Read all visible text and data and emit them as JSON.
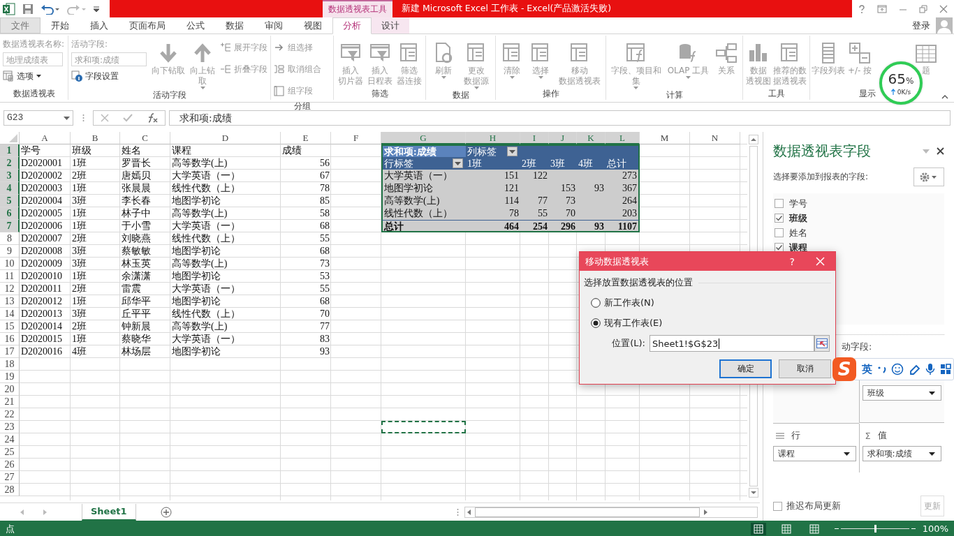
{
  "title_bar": {
    "context_tab": "数据透视表工具",
    "title": "新建 Microsoft Excel 工作表 -  Excel(产品激活失败)"
  },
  "ribbon_tabs": [
    {
      "label": "文件",
      "kind": "file",
      "selected": false
    },
    {
      "label": "开始",
      "kind": "main",
      "selected": false
    },
    {
      "label": "插入",
      "kind": "main",
      "selected": false
    },
    {
      "label": "页面布局",
      "kind": "main",
      "selected": false
    },
    {
      "label": "公式",
      "kind": "main",
      "selected": false
    },
    {
      "label": "数据",
      "kind": "main",
      "selected": false
    },
    {
      "label": "审阅",
      "kind": "main",
      "selected": false
    },
    {
      "label": "视图",
      "kind": "main",
      "selected": false
    },
    {
      "label": "分析",
      "kind": "context",
      "selected": true
    },
    {
      "label": "设计",
      "kind": "context",
      "selected": false
    }
  ],
  "account": {
    "label": "登录"
  },
  "ribbon_groups": [
    {
      "label": "数据透视表",
      "columns": [
        [
          {
            "kind": "caption",
            "text": "数据透视表名称:",
            "disabled": true
          },
          {
            "kind": "input",
            "value": "地理成绩表",
            "disabled": true
          },
          {
            "kind": "small",
            "text": "选项",
            "dropdown": true,
            "disabled": false
          }
        ]
      ]
    },
    {
      "label": "活动字段",
      "columns": [
        [
          {
            "kind": "caption",
            "text": "活动字段:",
            "disabled": true
          },
          {
            "kind": "input",
            "value": "求和项:成绩",
            "disabled": true
          },
          {
            "kind": "small",
            "text": "字段设置",
            "dropdown": false,
            "disabled": false
          }
        ],
        [
          {
            "kind": "large",
            "lines": [
              "向下钻取"
            ],
            "dropdown": false,
            "disabled": true
          }
        ],
        [
          {
            "kind": "large",
            "lines": [
              "向上钻",
              "取"
            ],
            "dropdown": true,
            "disabled": true
          }
        ],
        [
          {
            "kind": "small",
            "text": "展开字段",
            "dropdown": false,
            "disabled": true
          },
          {
            "kind": "small",
            "text": "折叠字段",
            "dropdown": false,
            "disabled": true
          }
        ]
      ]
    },
    {
      "label": "分组",
      "columns": [
        [
          {
            "kind": "small",
            "text": "组选择",
            "dropdown": false,
            "disabled": true
          },
          {
            "kind": "small",
            "text": "取消组合",
            "dropdown": false,
            "disabled": true
          },
          {
            "kind": "small",
            "text": "组字段",
            "dropdown": false,
            "disabled": true
          }
        ]
      ]
    },
    {
      "label": "筛选",
      "columns": [
        [
          {
            "kind": "large",
            "lines": [
              "插入",
              "切片器"
            ],
            "dropdown": false,
            "disabled": true
          }
        ],
        [
          {
            "kind": "large",
            "lines": [
              "插入",
              "日程表"
            ],
            "dropdown": false,
            "disabled": true
          }
        ],
        [
          {
            "kind": "large",
            "lines": [
              "筛选",
              "器连接"
            ],
            "dropdown": false,
            "disabled": true
          }
        ]
      ]
    },
    {
      "label": "数据",
      "columns": [
        [
          {
            "kind": "large",
            "lines": [
              "刷新"
            ],
            "dropdown": true,
            "disabled": true
          }
        ],
        [
          {
            "kind": "large",
            "lines": [
              "更改",
              "数据源"
            ],
            "dropdown": true,
            "disabled": true
          }
        ]
      ]
    },
    {
      "label": "操作",
      "columns": [
        [
          {
            "kind": "large",
            "lines": [
              "清除"
            ],
            "dropdown": true,
            "disabled": true
          }
        ],
        [
          {
            "kind": "large",
            "lines": [
              "选择"
            ],
            "dropdown": true,
            "disabled": true
          }
        ],
        [
          {
            "kind": "large",
            "lines": [
              "移动",
              "数据透视表"
            ],
            "dropdown": false,
            "disabled": true
          }
        ]
      ]
    },
    {
      "label": "计算",
      "columns": [
        [
          {
            "kind": "large",
            "lines": [
              "字段、项目和",
              "集"
            ],
            "dropdown": true,
            "disabled": true
          }
        ],
        [
          {
            "kind": "large",
            "lines": [
              "OLAP 工具"
            ],
            "dropdown": true,
            "disabled": true
          }
        ],
        [
          {
            "kind": "large",
            "lines": [
              "关系"
            ],
            "dropdown": false,
            "disabled": true
          }
        ]
      ]
    },
    {
      "label": "工具",
      "columns": [
        [
          {
            "kind": "large",
            "lines": [
              "数据",
              "透视图"
            ],
            "dropdown": false,
            "disabled": true
          }
        ],
        [
          {
            "kind": "large",
            "lines": [
              "推荐的数",
              "据透视表"
            ],
            "dropdown": false,
            "disabled": true
          }
        ]
      ]
    },
    {
      "label": "显示",
      "columns": [
        [
          {
            "kind": "large",
            "lines": [
              "字段列表"
            ],
            "dropdown": false,
            "disabled": true
          }
        ],
        [
          {
            "kind": "large",
            "lines": [
              "+/- 按"
            ],
            "dropdown": false,
            "disabled": true
          }
        ],
        [
          {
            "kind": "large",
            "lines": [
              "题"
            ],
            "dropdown": false,
            "disabled": true
          }
        ]
      ]
    }
  ],
  "formula_bar": {
    "name_box": "G23",
    "formula": "求和项:成绩"
  },
  "sheet": {
    "column_headers": [
      {
        "label": "A",
        "selected": false,
        "marquee": false
      },
      {
        "label": "B",
        "selected": false,
        "marquee": false
      },
      {
        "label": "C",
        "selected": false,
        "marquee": false
      },
      {
        "label": "D",
        "selected": false,
        "marquee": false
      },
      {
        "label": "E",
        "selected": false,
        "marquee": false
      },
      {
        "label": "F",
        "selected": false,
        "marquee": false
      },
      {
        "label": "G",
        "selected": true,
        "marquee": true
      },
      {
        "label": "H",
        "selected": true,
        "marquee": false
      },
      {
        "label": "I",
        "selected": true,
        "marquee": false
      },
      {
        "label": "J",
        "selected": true,
        "marquee": false
      },
      {
        "label": "K",
        "selected": true,
        "marquee": false
      },
      {
        "label": "L",
        "selected": true,
        "marquee": false
      },
      {
        "label": "M",
        "selected": false,
        "marquee": false
      },
      {
        "label": "N",
        "selected": false,
        "marquee": false
      }
    ],
    "rows": [
      {
        "number": "1",
        "selected": true,
        "marquee": false,
        "cells": [
          "学号",
          "班级",
          "姓名",
          "课程",
          "成绩"
        ]
      },
      {
        "number": "2",
        "selected": true,
        "marquee": false,
        "cells": [
          "D2020001",
          "1班",
          "罗晋长",
          "高等数学(上)",
          "56"
        ]
      },
      {
        "number": "3",
        "selected": true,
        "marquee": false,
        "cells": [
          "D2020002",
          "2班",
          "唐嫣贝",
          "大学英语（一）",
          "67"
        ]
      },
      {
        "number": "4",
        "selected": true,
        "marquee": false,
        "cells": [
          "D2020003",
          "1班",
          "张晨晨",
          "线性代数（上）",
          "78"
        ]
      },
      {
        "number": "5",
        "selected": true,
        "marquee": false,
        "cells": [
          "D2020004",
          "3班",
          "李长春",
          "地图学初论",
          "85"
        ]
      },
      {
        "number": "6",
        "selected": true,
        "marquee": false,
        "cells": [
          "D2020005",
          "1班",
          "林子中",
          "高等数学(上)",
          "58"
        ]
      },
      {
        "number": "7",
        "selected": true,
        "marquee": false,
        "cells": [
          "D2020006",
          "1班",
          "于小雪",
          "大学英语（一）",
          "68"
        ]
      },
      {
        "number": "8",
        "selected": false,
        "marquee": false,
        "cells": [
          "D2020007",
          "2班",
          "刘晓燕",
          "线性代数（上）",
          "55"
        ]
      },
      {
        "number": "9",
        "selected": false,
        "marquee": false,
        "cells": [
          "D2020008",
          "3班",
          "蔡敏敏",
          "地图学初论",
          "68"
        ]
      },
      {
        "number": "10",
        "selected": false,
        "marquee": false,
        "cells": [
          "D2020009",
          "3班",
          "林玉英",
          "高等数学(上)",
          "73"
        ]
      },
      {
        "number": "11",
        "selected": false,
        "marquee": false,
        "cells": [
          "D2020010",
          "1班",
          "余潇潇",
          "地图学初论",
          "53"
        ]
      },
      {
        "number": "12",
        "selected": false,
        "marquee": false,
        "cells": [
          "D2020011",
          "2班",
          "雷震",
          "大学英语（一）",
          "55"
        ]
      },
      {
        "number": "13",
        "selected": false,
        "marquee": false,
        "cells": [
          "D2020012",
          "1班",
          "邱华平",
          "地图学初论",
          "68"
        ]
      },
      {
        "number": "14",
        "selected": false,
        "marquee": false,
        "cells": [
          "D2020013",
          "3班",
          "丘平平",
          "线性代数（上）",
          "70"
        ]
      },
      {
        "number": "15",
        "selected": false,
        "marquee": false,
        "cells": [
          "D2020014",
          "2班",
          "钟新晨",
          "高等数学(上)",
          "77"
        ]
      },
      {
        "number": "16",
        "selected": false,
        "marquee": false,
        "cells": [
          "D2020015",
          "1班",
          "蔡晓华",
          "大学英语（一）",
          "83"
        ]
      },
      {
        "number": "17",
        "selected": false,
        "marquee": false,
        "cells": [
          "D2020016",
          "4班",
          "林场层",
          "地图学初论",
          "93"
        ]
      },
      {
        "number": "18",
        "selected": false,
        "marquee": false
      },
      {
        "number": "19",
        "selected": false,
        "marquee": false
      },
      {
        "number": "20",
        "selected": false,
        "marquee": false
      },
      {
        "number": "21",
        "selected": false,
        "marquee": false
      },
      {
        "number": "22",
        "selected": false,
        "marquee": false
      },
      {
        "number": "23",
        "selected": false,
        "marquee": true
      },
      {
        "number": "24",
        "selected": false,
        "marquee": false
      },
      {
        "number": "25",
        "selected": false,
        "marquee": false
      },
      {
        "number": "26",
        "selected": false,
        "marquee": false
      },
      {
        "number": "27",
        "selected": false,
        "marquee": false
      },
      {
        "number": "28",
        "selected": false,
        "marquee": false
      }
    ]
  },
  "pivot": {
    "corner": "求和项:成绩",
    "column_label": "列标签",
    "row_label": "行标签",
    "columns": [
      "1班",
      "2班",
      "3班",
      "4班",
      "总计"
    ],
    "rows": [
      {
        "label": "大学英语（一）",
        "values": {
          "c1": "151",
          "c2": "122",
          "c5": "273"
        }
      },
      {
        "label": "地图学初论",
        "values": {
          "c1": "121",
          "c3": "153",
          "c4": "93",
          "c5": "367"
        }
      },
      {
        "label": "高等数学(上)",
        "values": {
          "c1": "114",
          "c2": "77",
          "c3": "73",
          "c5": "264"
        }
      },
      {
        "label": "线性代数（上）",
        "values": {
          "c1": "78",
          "c2": "55",
          "c3": "70",
          "c5": "203"
        }
      }
    ],
    "total": {
      "label": "总计",
      "values": {
        "c1": "464",
        "c2": "254",
        "c3": "296",
        "c4": "93",
        "c5": "1107"
      }
    }
  },
  "sheet_tabs": [
    {
      "label": "Sheet1",
      "selected": true
    }
  ],
  "field_pane": {
    "title": "数据透视表字段",
    "subtitle": "选择要添加到报表的字段:",
    "fields": [
      {
        "label": "学号",
        "checked": false
      },
      {
        "label": "班级",
        "checked": true
      },
      {
        "label": "姓名",
        "checked": false
      },
      {
        "label": "课程",
        "checked": true
      }
    ],
    "areas_caption": "动字段:",
    "column_field": "班级",
    "rows_header": "行",
    "values_symbol": "Σ",
    "values_header": "值",
    "row_field": "课程",
    "value_field": "求和项:成绩",
    "defer_label": "推迟布局更新",
    "defer_checked": false,
    "update_button": "更新"
  },
  "dialog": {
    "title": "移动数据透视表",
    "help": "?",
    "section": "选择放置数据透视表的位置",
    "options": [
      {
        "label": "新工作表(N)",
        "selected": false
      },
      {
        "label": "现有工作表(E)",
        "selected": true
      }
    ],
    "location_label": "位置(L):",
    "location_value": "Sheet1!$G$23",
    "ok": "确定",
    "cancel": "取消"
  },
  "ime_toolbar": {
    "logo": "S",
    "mode": "英"
  },
  "speed_widget": {
    "percent": "65",
    "unit": "%",
    "rate": "0K/s"
  },
  "status_bar": {
    "mode": "点",
    "views": [
      {
        "selected": true
      },
      {
        "selected": false
      },
      {
        "selected": false
      }
    ],
    "zoom": {
      "level": 0.5
    },
    "zoom_label": "100%"
  }
}
